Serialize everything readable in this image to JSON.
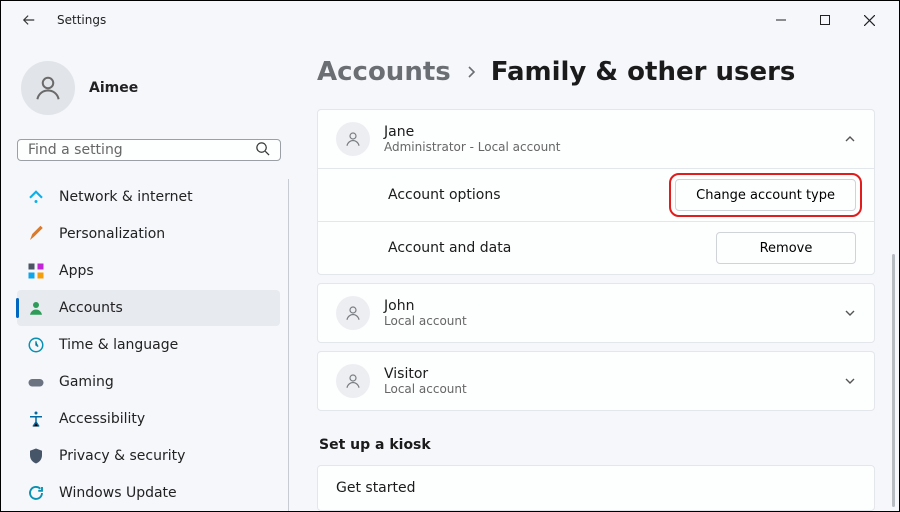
{
  "window": {
    "title": "Settings"
  },
  "profile": {
    "name": "Aimee"
  },
  "search": {
    "placeholder": "Find a setting"
  },
  "nav": {
    "network": "Network & internet",
    "personalization": "Personalization",
    "apps": "Apps",
    "accounts": "Accounts",
    "time": "Time & language",
    "gaming": "Gaming",
    "accessibility": "Accessibility",
    "privacy": "Privacy & security",
    "update": "Windows Update"
  },
  "breadcrumb": {
    "parent": "Accounts",
    "current": "Family & other users"
  },
  "users": [
    {
      "name": "Jane",
      "subtitle": "Administrator - Local account"
    },
    {
      "name": "John",
      "subtitle": "Local account"
    },
    {
      "name": "Visitor",
      "subtitle": "Local account"
    }
  ],
  "expanded": {
    "account_options_label": "Account options",
    "change_type_label": "Change account type",
    "account_data_label": "Account and data",
    "remove_label": "Remove"
  },
  "kiosk": {
    "title": "Set up a kiosk",
    "get_started": "Get started"
  }
}
